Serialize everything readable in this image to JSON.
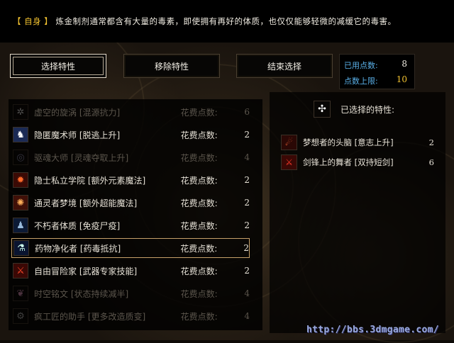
{
  "description": {
    "tag": "【 自身 】",
    "text": "炼金制剂通常都含有大量的毒素，即使拥有再好的体质，也仅仅能够轻微的减缓它的毒害。"
  },
  "buttons": {
    "select": "选择特性",
    "remove": "移除特性",
    "finish": "结束选择"
  },
  "points": {
    "used_label": "已用点数:",
    "used_value": "8",
    "max_label": "点数上限:",
    "max_value": "10"
  },
  "traits": [
    {
      "name": "虚空的旋涡 [混源抗力]",
      "cost_label": "花费点数:",
      "cost": "6",
      "state": "disabled",
      "icon": "vortex-icon"
    },
    {
      "name": "隐匿魔术师 [脱逃上升]",
      "cost_label": "花费点数:",
      "cost": "2",
      "state": "available",
      "icon": "kangaroo-icon"
    },
    {
      "name": "驱魂大师 [灵魂夺取上升]",
      "cost_label": "花费点数:",
      "cost": "4",
      "state": "disabled",
      "icon": "soul-icon"
    },
    {
      "name": "隐士私立学院 [额外元素魔法]",
      "cost_label": "花费点数:",
      "cost": "2",
      "state": "available",
      "icon": "flame-icon"
    },
    {
      "name": "通灵者梦境 [额外超能魔法]",
      "cost_label": "花费点数:",
      "cost": "2",
      "state": "available",
      "icon": "psychic-icon"
    },
    {
      "name": "不朽者体质 [免疫尸疫]",
      "cost_label": "花费点数:",
      "cost": "2",
      "state": "available",
      "icon": "figure-icon"
    },
    {
      "name": "药物净化者 [药毒抵抗]",
      "cost_label": "花费点数:",
      "cost": "2",
      "state": "selected",
      "icon": "potion-icon"
    },
    {
      "name": "自由冒险家 [武器专家技能]",
      "cost_label": "花费点数:",
      "cost": "2",
      "state": "available",
      "icon": "weapons-icon"
    },
    {
      "name": "时空铭文 [状态持续减半]",
      "cost_label": "花费点数:",
      "cost": "4",
      "state": "disabled",
      "icon": "rune-icon"
    },
    {
      "name": "疯工匠的助手 [更多改造质变]",
      "cost_label": "花费点数:",
      "cost": "4",
      "state": "disabled",
      "icon": "gear-icon"
    }
  ],
  "selected_panel": {
    "title": "已选择的特性:",
    "items": [
      {
        "name": "梦想者的头脑 [意志上升]",
        "cost": "2",
        "icon": "mind-icon"
      },
      {
        "name": "剑锋上的舞者 [双持短剑]",
        "cost": "6",
        "icon": "blades-icon"
      }
    ]
  },
  "watermark": "http://bbs.3dmgame.com/",
  "colors": {
    "tag": "#f2c230",
    "points_label": "#5ab0e8",
    "highlight_border": "#c6a06a"
  }
}
